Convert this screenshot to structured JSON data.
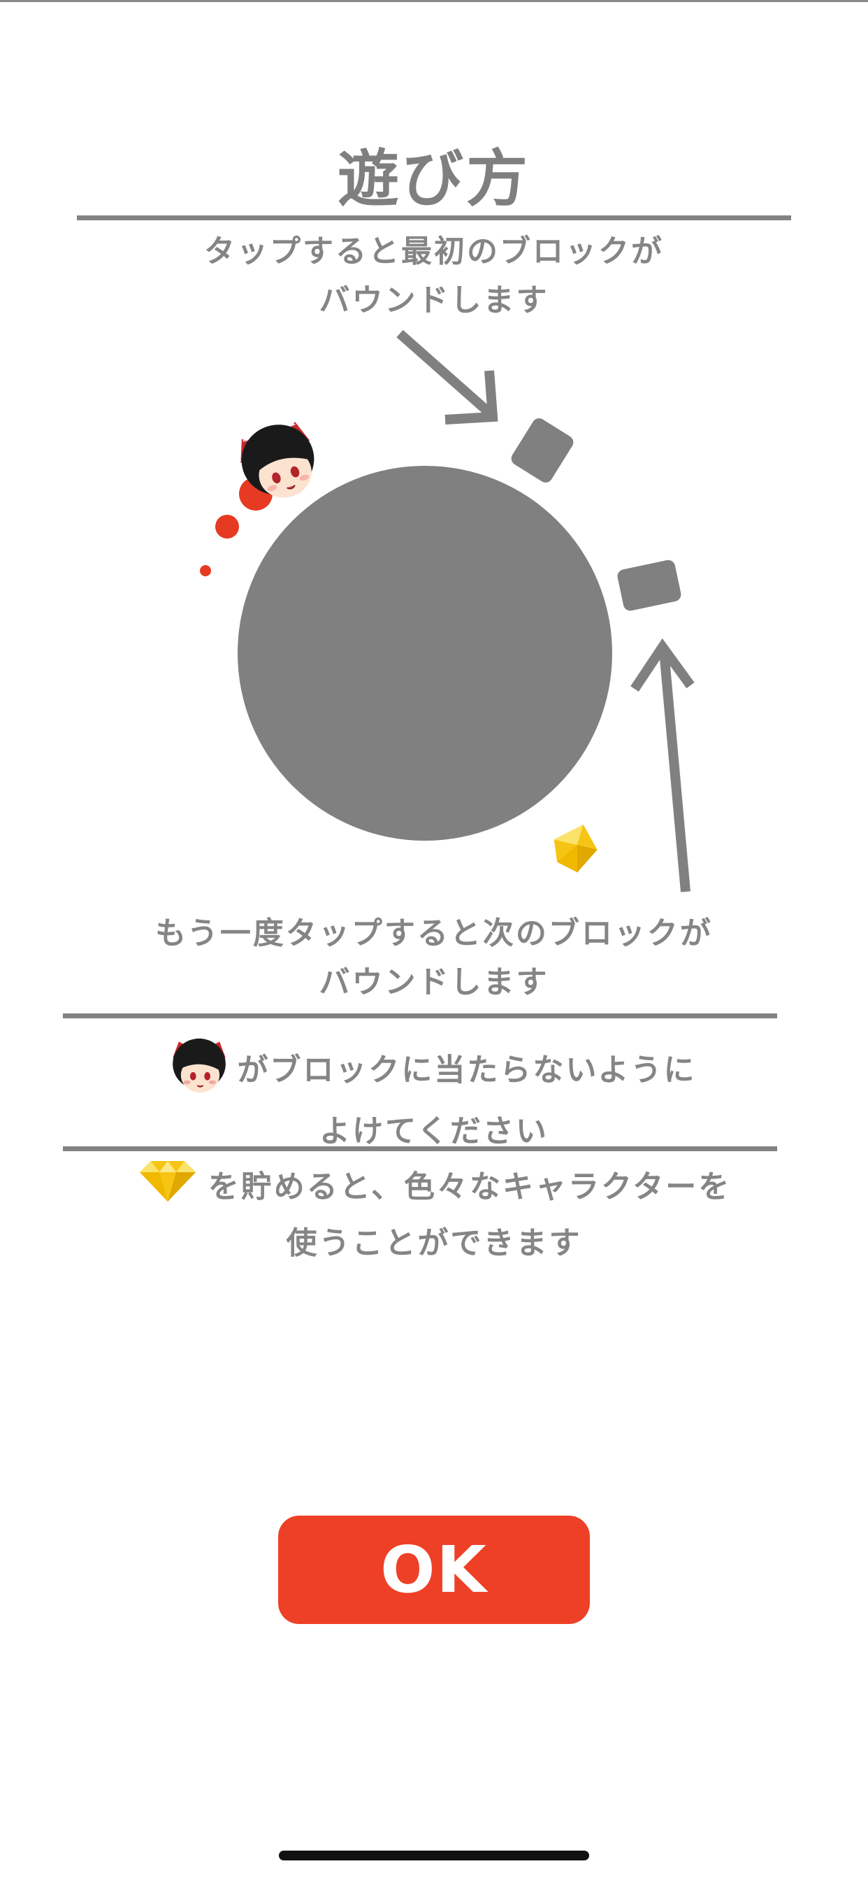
{
  "title": "遊び方",
  "instructions": {
    "tap_first": {
      "line1": "タップすると最初のブロックが",
      "line2": "バウンドします"
    },
    "tap_again": {
      "line1": "もう一度タップすると次のブロックが",
      "line2": "バウンドします"
    },
    "avoid": {
      "line1": "がブロックに当たらないように",
      "line2": "よけてください"
    },
    "gems": {
      "line1": "を貯めると、色々なキャラクターを",
      "line2": "使うことができます"
    }
  },
  "ok_button": {
    "label": "OK"
  },
  "colors": {
    "accent_red": "#ee4026",
    "gray": "#808080",
    "gem_gold": "#f6c514"
  },
  "icons": {
    "character": "character-head-icon",
    "gem": "gem-icon"
  }
}
